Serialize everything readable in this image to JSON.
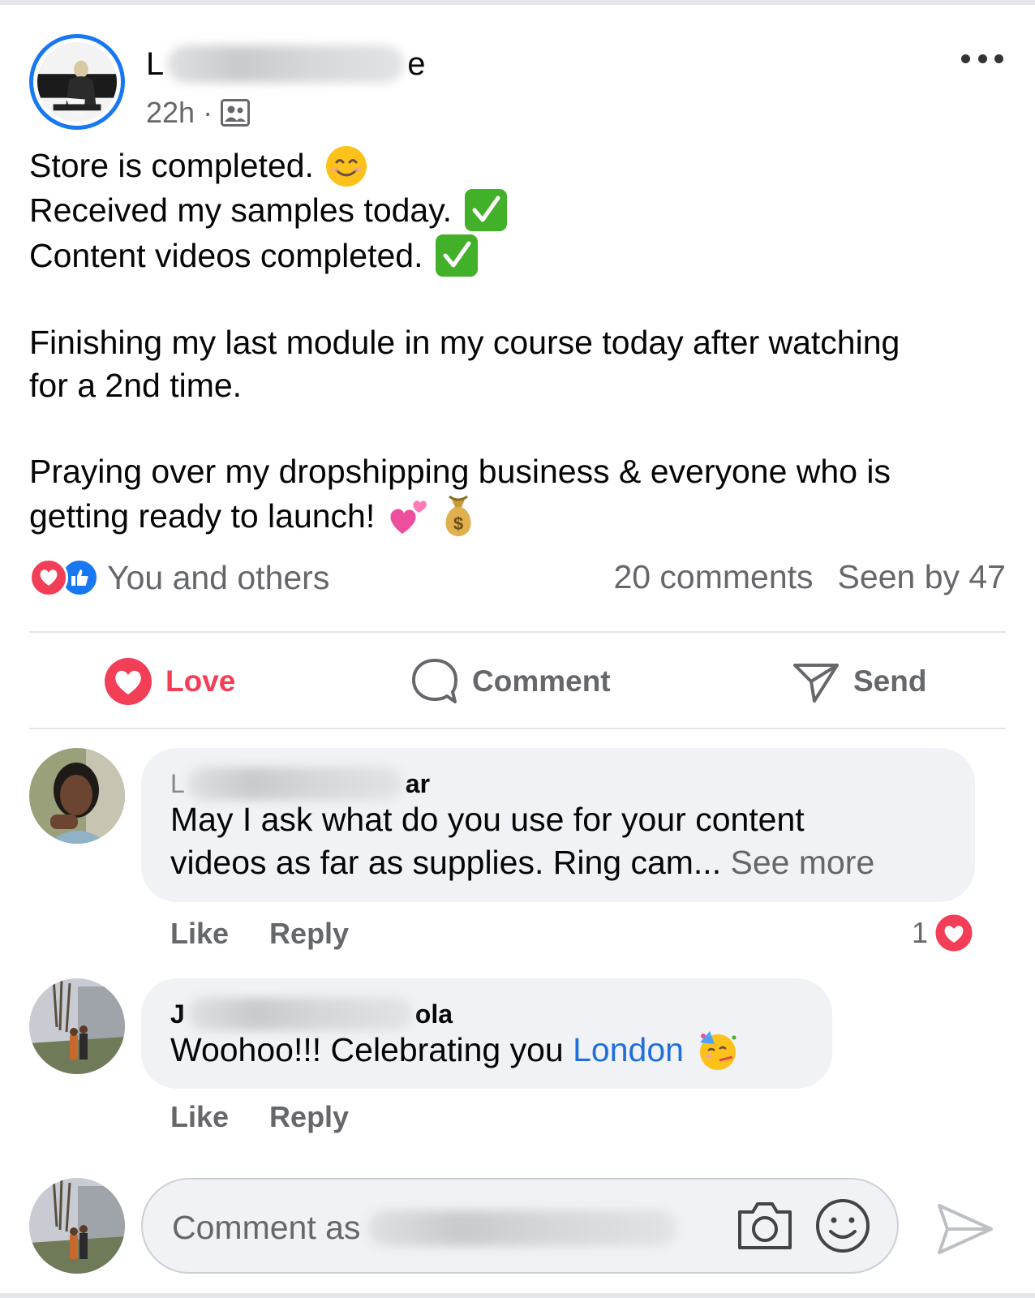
{
  "post": {
    "author_prefix": "L",
    "author_suffix": "e",
    "time": "22h",
    "dot": "·",
    "privacy_icon": "group-icon",
    "lines": [
      "Store is completed.",
      "Received my samples today.",
      "Content videos completed.",
      "Finishing my last module in my course today after watching",
      "for a 2nd time.",
      "Praying over my dropshipping business & everyone who is",
      "getting ready to launch!"
    ],
    "emojis": {
      "line1": "smiling-face-emoji",
      "line2": "check-mark-button-emoji",
      "line3": "check-mark-button-emoji",
      "line7": [
        "two-hearts-emoji",
        "money-bag-emoji"
      ]
    }
  },
  "summary": {
    "reactions_label": "You and others",
    "comments": "20 comments",
    "seen": "Seen by 47"
  },
  "actions": {
    "love": "Love",
    "comment": "Comment",
    "send": "Send"
  },
  "comments": [
    {
      "name_prefix": "L",
      "name_suffix": "ar",
      "text_line1": "May I ask what do you use for your content",
      "text_line2": "videos as far as supplies. Ring cam...",
      "see_more": "See more",
      "like": "Like",
      "reply": "Reply",
      "reaction_count": "1"
    },
    {
      "name_prefix": "J",
      "name_suffix": "ola",
      "text": "Woohoo!!! Celebrating you",
      "mention": "London",
      "emoji": "partying-face-emoji",
      "like": "Like",
      "reply": "Reply"
    }
  ],
  "composer": {
    "placeholder": "Comment as"
  },
  "colors": {
    "love": "#f33e58",
    "like_blue": "#1877f2",
    "muted": "#65676b",
    "bubble": "#f0f2f5",
    "mention": "#216fdb"
  }
}
